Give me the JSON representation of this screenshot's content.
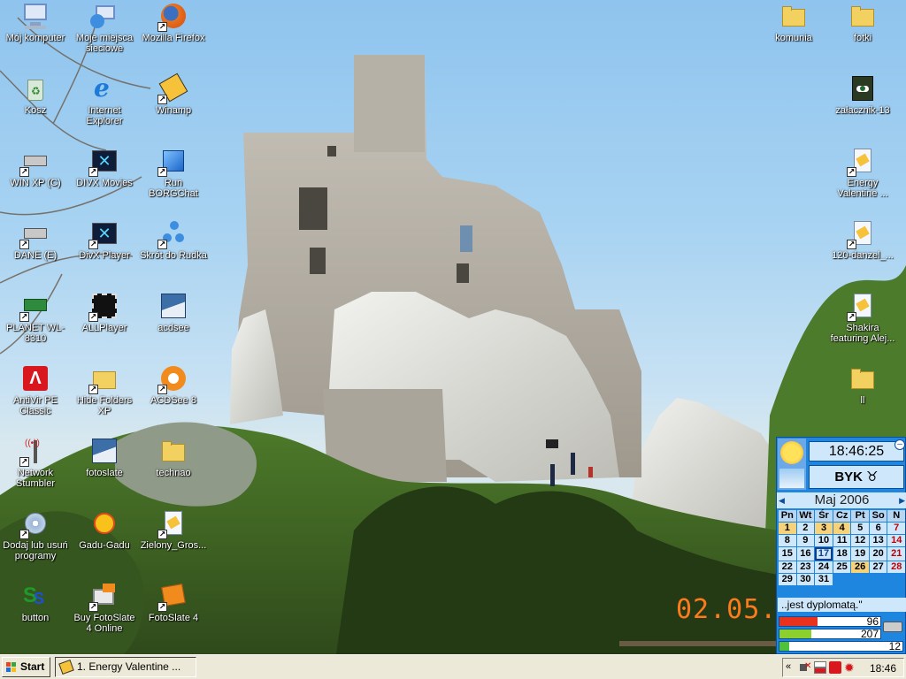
{
  "desktop_left": [
    {
      "label": "Mój komputer",
      "icon": "my-computer-icon"
    },
    {
      "label": "Moje miejsca sieciowe",
      "icon": "network-places-icon"
    },
    {
      "label": "Mozilla Firefox",
      "icon": "firefox-icon"
    },
    {
      "label": "Kosz",
      "icon": "recycle-bin-icon"
    },
    {
      "label": "Internet Explorer",
      "icon": "internet-explorer-icon"
    },
    {
      "label": "Winamp",
      "icon": "winamp-icon"
    },
    {
      "label": "WIN XP (C)",
      "icon": "drive-c-icon"
    },
    {
      "label": "DIVX Movies",
      "icon": "divx-movies-icon"
    },
    {
      "label": "Run BORGChat",
      "icon": "borgchat-icon"
    },
    {
      "label": "DANE (E)",
      "icon": "drive-e-icon"
    },
    {
      "label": "DivX Player",
      "icon": "divx-player-icon"
    },
    {
      "label": "Skrót do Rudka",
      "icon": "network-shortcut-icon"
    },
    {
      "label": "PLANET WL-8310",
      "icon": "network-card-icon"
    },
    {
      "label": "ALLPlayer",
      "icon": "allplayer-icon"
    },
    {
      "label": "acdsee",
      "icon": "acdsee-icon"
    },
    {
      "label": "AntiVir PE Classic",
      "icon": "antivir-icon"
    },
    {
      "label": "Hide Folders XP",
      "icon": "hide-folders-icon"
    },
    {
      "label": "ACDSee 8",
      "icon": "acdsee8-icon"
    },
    {
      "label": "Network Stumbler",
      "icon": "netstumbler-icon"
    },
    {
      "label": "fotoslate",
      "icon": "fotoslate-icon"
    },
    {
      "label": "technao",
      "icon": "folder-icon"
    },
    {
      "label": "Dodaj lub usuń programy",
      "icon": "add-remove-programs-icon"
    },
    {
      "label": "Gadu-Gadu",
      "icon": "gadu-gadu-icon"
    },
    {
      "label": "Zielony_Gros...",
      "icon": "document-icon"
    },
    {
      "label": "button",
      "icon": "button-app-icon"
    },
    {
      "label": "Buy FotoSlate 4 Online",
      "icon": "buy-fotoslate-icon"
    },
    {
      "label": "FotoSlate 4",
      "icon": "fotoslate4-icon"
    }
  ],
  "desktop_right": [
    {
      "label": "komunia",
      "icon": "folder-icon"
    },
    {
      "label": "fotki",
      "icon": "folder-icon"
    },
    {
      "label": "załacznik-13",
      "icon": "image-file-icon"
    },
    {
      "label": "Energy Valentine ...",
      "icon": "winamp-file-icon"
    },
    {
      "label": "120-danzel_...",
      "icon": "winamp-file-icon"
    },
    {
      "label": "Shakira featuring Alej...",
      "icon": "winamp-file-icon"
    },
    {
      "label": "ll",
      "icon": "folder-icon"
    }
  ],
  "gadget": {
    "time": "18:46:25",
    "zodiac_label": "BYK ♉",
    "month": "Maj 2006",
    "weekdays": [
      "Pn",
      "Wt",
      "Śr",
      "Cz",
      "Pt",
      "So",
      "N"
    ],
    "weeks": [
      [
        "1",
        "2",
        "3",
        "4",
        "5",
        "6",
        "7"
      ],
      [
        "8",
        "9",
        "10",
        "11",
        "12",
        "13",
        "14"
      ],
      [
        "15",
        "16",
        "17",
        "18",
        "19",
        "20",
        "21"
      ],
      [
        "22",
        "23",
        "24",
        "25",
        "26",
        "27",
        "28"
      ],
      [
        "29",
        "30",
        "31",
        "",
        "",
        "",
        ""
      ]
    ],
    "highlighted": [
      "1",
      "3",
      "4",
      "26"
    ],
    "today": "17",
    "quote": "..jest dyplomatą.\"",
    "bars": [
      {
        "value": "96",
        "fraction": 0.38,
        "color": "#e8321e"
      },
      {
        "value": "207",
        "fraction": 0.32,
        "color": "#8bd02c"
      },
      {
        "value": "12",
        "fraction": 0.08,
        "color": "#4fc13a"
      }
    ]
  },
  "date_stamp": "02.05.",
  "taskbar": {
    "start_label": "Start",
    "task_label": "1. Energy Valentine ...",
    "clock": "18:46",
    "tray_chevron": "«"
  }
}
